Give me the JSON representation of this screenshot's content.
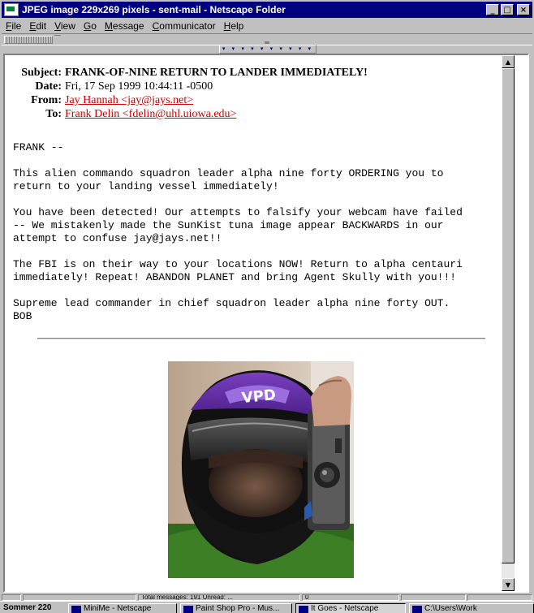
{
  "window": {
    "title": "JPEG image 229x269 pixels - sent-mail - Netscape Folder",
    "minimize": "_",
    "maximize": "□",
    "close": "×"
  },
  "menu": [
    "File",
    "Edit",
    "View",
    "Go",
    "Message",
    "Communicator",
    "Help"
  ],
  "collapser_glyphs": "▾ ▾ ▾ ▾ ▾ ▾ ▾ ▾ ▾ ▾ ▾",
  "message": {
    "headers": {
      "subject_label": "Subject:",
      "subject": "FRANK-OF-NINE RETURN TO LANDER IMMEDIATELY!",
      "date_label": "Date:",
      "date": "Fri, 17 Sep 1999 10:44:11 -0500",
      "from_label": "From:",
      "from": "Jay Hannah <jay@jays.net>",
      "to_label": "To:",
      "to": "Frank Delin <fdelin@uhl.uiowa.edu>"
    },
    "body": [
      "FRANK --",
      "This alien commando squadron leader alpha nine forty ORDERING you to\nreturn to your landing vessel immediately!",
      "You have been detected! Our attempts to falsify your webcam have failed\n-- We mistakenly made the SunKist tuna image appear BACKWARDS in our\nattempt to confuse jay@jays.net!!",
      "The FBI is on their way to your locations NOW! Return to alpha centauri\nimmediately! Repeat! ABANDON PLANET and bring Agent Skully with you!!!",
      "Supreme lead commander in chief squadron leader alpha nine forty OUT.\nBOB"
    ],
    "attachment": {
      "description": "photo of person wearing purple motorcycle helmet holding a camcorder",
      "helmet_text": "VPD"
    }
  },
  "scrollbar": {
    "up": "▲",
    "down": "▼"
  },
  "statusbar": {
    "cells": [
      "",
      "",
      "Total messages: 191    Unread: ...",
      "0",
      "",
      ""
    ]
  },
  "taskbar": {
    "start_text": "Sommer 220",
    "tasks": [
      "MiniMe - Netscape",
      "Paint Shop Pro - Mus...",
      "It Goes - Netscape",
      "C:\\Users\\Work"
    ]
  }
}
